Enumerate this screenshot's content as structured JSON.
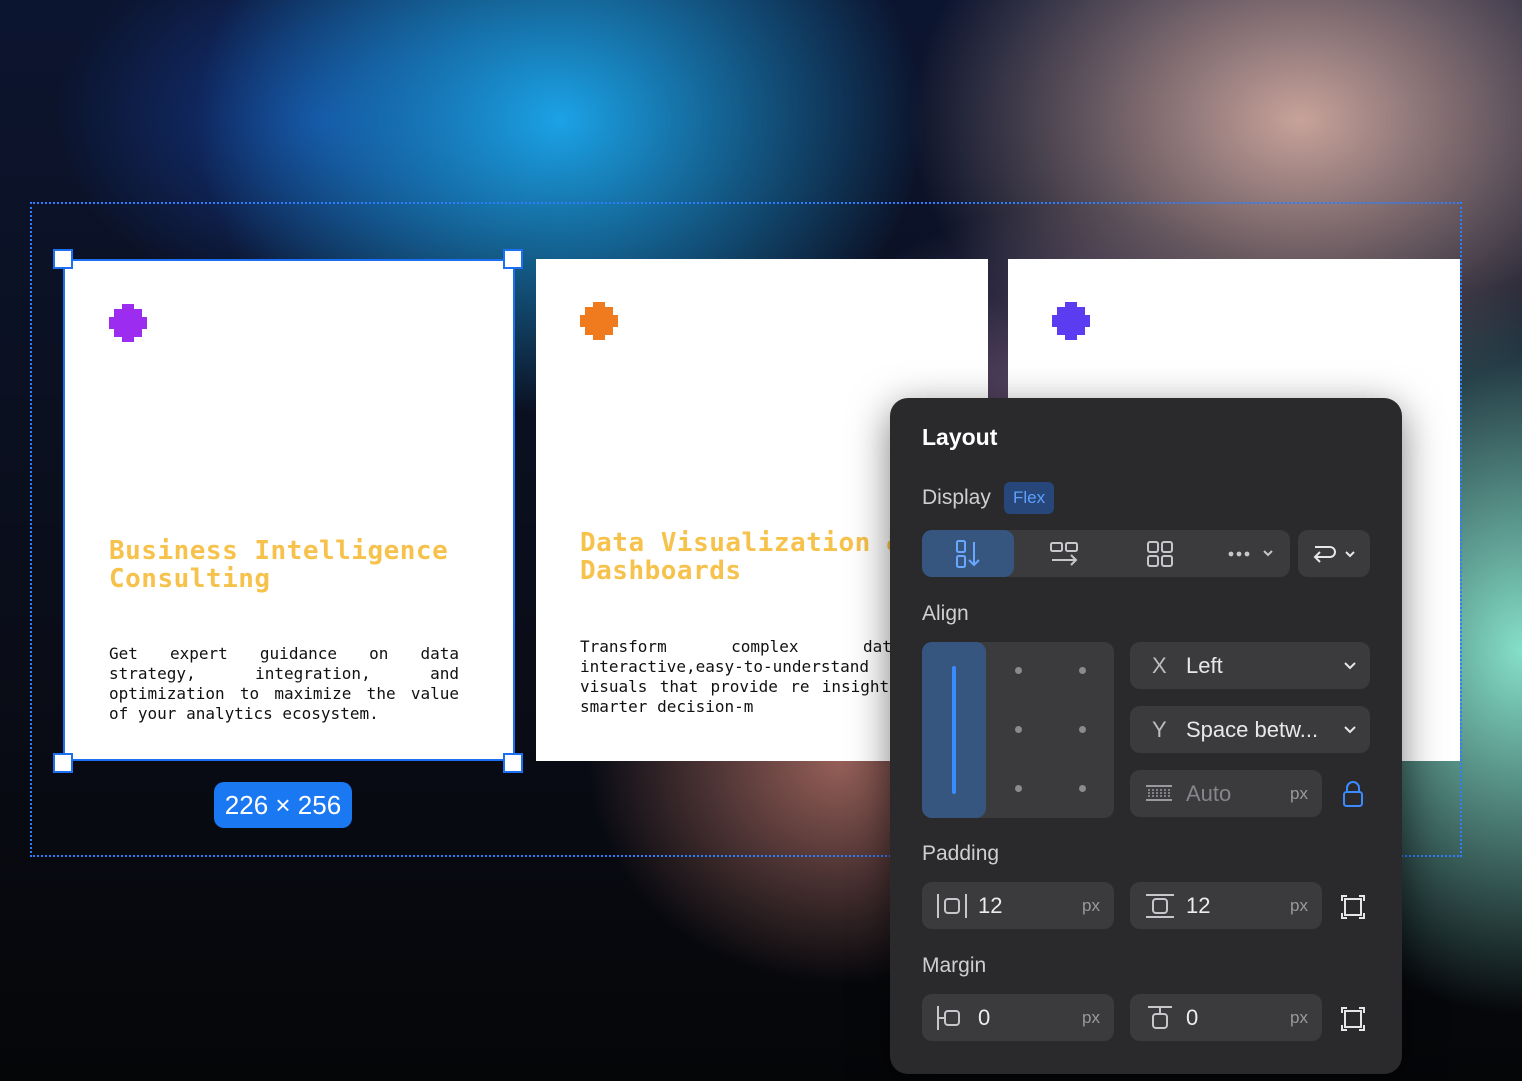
{
  "cards": [
    {
      "shape_color": "#9b2cf0",
      "title": "Business Intelligence Consulting",
      "description": "Get expert guidance on data strategy, integration, and optimization to maximize the value of your analytics ecosystem."
    },
    {
      "shape_color": "#f07a1e",
      "title": "Data Visualization & Dashboards",
      "description": "Transform complex datasets interactive,easy-to-understand visuals that provide re insights for smarter decision-m"
    },
    {
      "shape_color": "#5b3cf0",
      "title": "",
      "description": ""
    }
  ],
  "selection": {
    "size_label": "226 × 256"
  },
  "panel": {
    "title": "Layout",
    "display": {
      "label": "Display",
      "badge": "Flex"
    },
    "align": {
      "label": "Align",
      "x": {
        "axis": "X",
        "value": "Left"
      },
      "y": {
        "axis": "Y",
        "value": "Space betw..."
      },
      "gap": {
        "placeholder": "Auto",
        "unit": "px"
      }
    },
    "padding": {
      "label": "Padding",
      "horizontal": {
        "value": "12",
        "unit": "px"
      },
      "vertical": {
        "value": "12",
        "unit": "px"
      }
    },
    "margin": {
      "label": "Margin",
      "horizontal": {
        "value": "0",
        "unit": "px"
      },
      "vertical": {
        "value": "0",
        "unit": "px"
      }
    }
  },
  "colors": {
    "accent": "#1d6ff2",
    "title_yellow": "#f6c24b",
    "panel_bg": "#2a2a2c"
  }
}
